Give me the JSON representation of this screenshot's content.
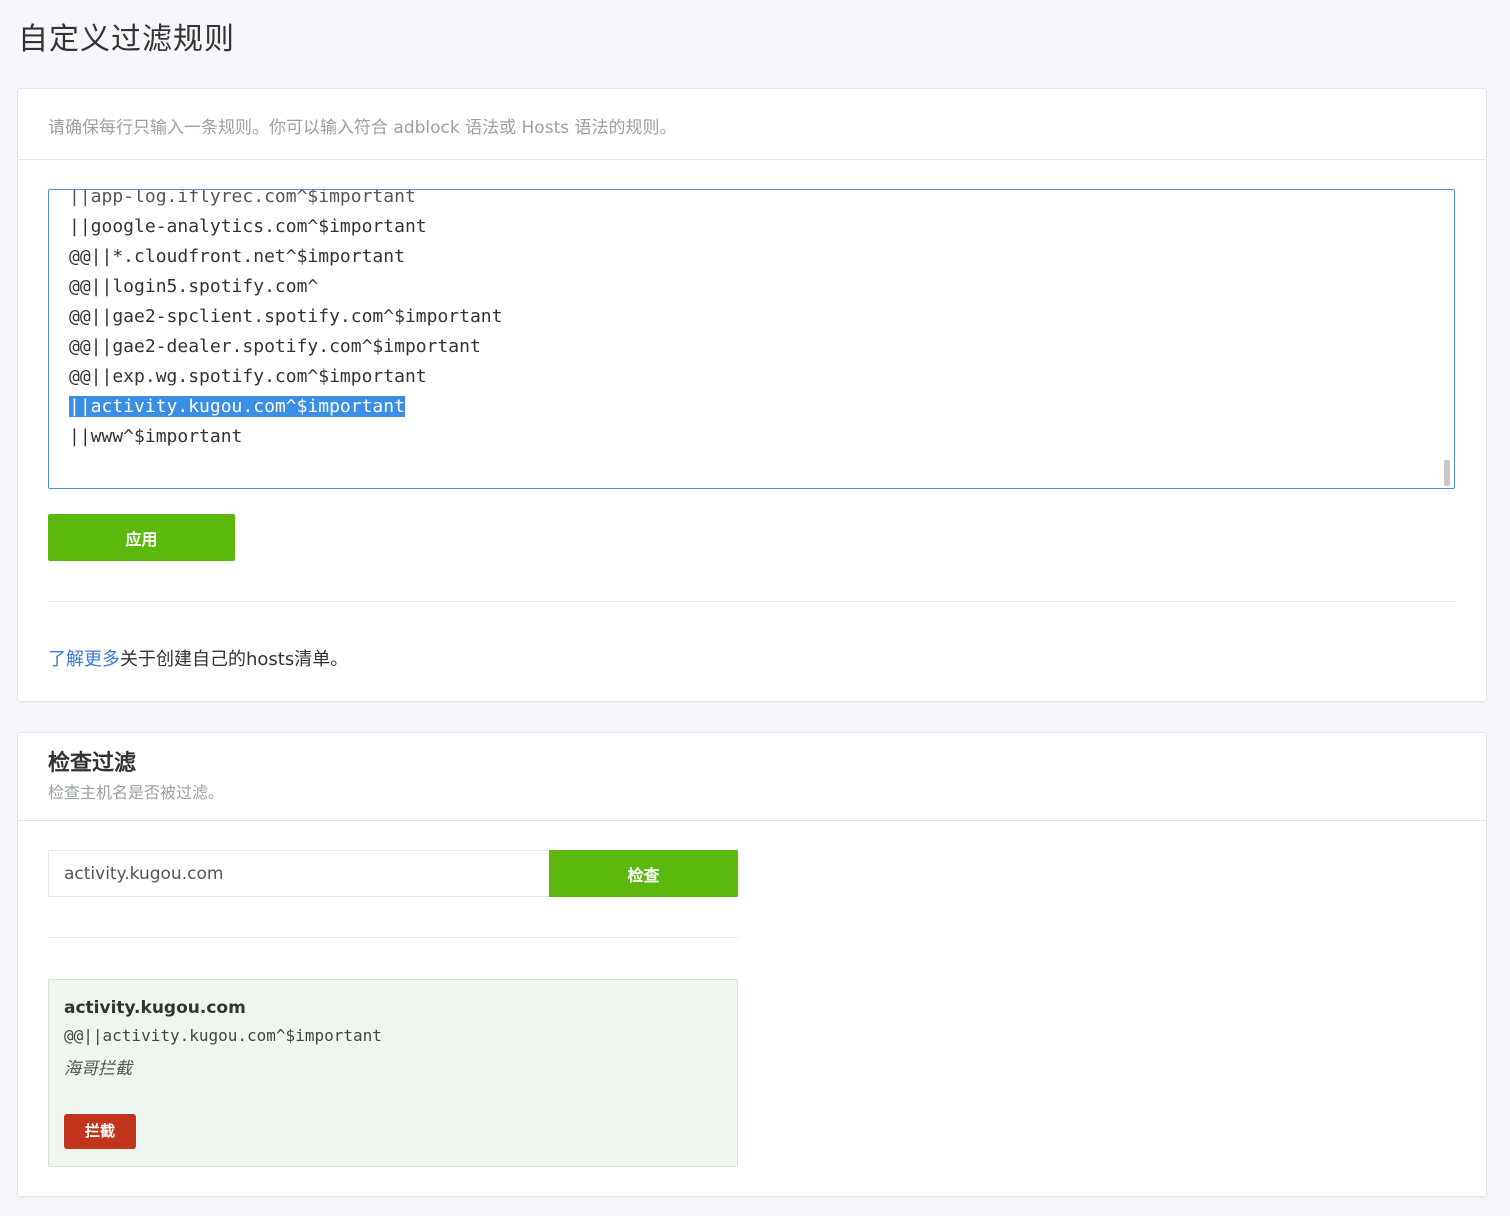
{
  "page": {
    "title": "自定义过滤规则"
  },
  "rules_card": {
    "description": "请确保每行只输入一条规则。你可以输入符合 adblock 语法或 Hosts 语法的规则。",
    "editor_lines": [
      "||app-log.iflyrec.com^$important",
      "||google-analytics.com^$important",
      "@@||*.cloudfront.net^$important",
      "@@||login5.spotify.com^",
      "@@||gae2-spclient.spotify.com^$important",
      "@@||gae2-dealer.spotify.com^$important",
      "@@||exp.wg.spotify.com^$important",
      "||activity.kugou.com^$important",
      "||www^$important"
    ],
    "selected_line_index": 7,
    "apply_label": "应用",
    "learn_more_link": "了解更多",
    "learn_more_rest": "关于创建自己的hosts清单。"
  },
  "check_card": {
    "title": "检查过滤",
    "subtitle": "检查主机名是否被过滤。",
    "input_value": "activity.kugou.com",
    "check_label": "检查",
    "result": {
      "host": "activity.kugou.com",
      "rule": "@@||activity.kugou.com^$important",
      "source": "海哥拦截",
      "status": "拦截",
      "status_color": "#c0351b"
    }
  },
  "colors": {
    "accent_green": "#5cb80c",
    "link_blue": "#3a7bd5",
    "selection_blue": "#3a8ee6"
  }
}
